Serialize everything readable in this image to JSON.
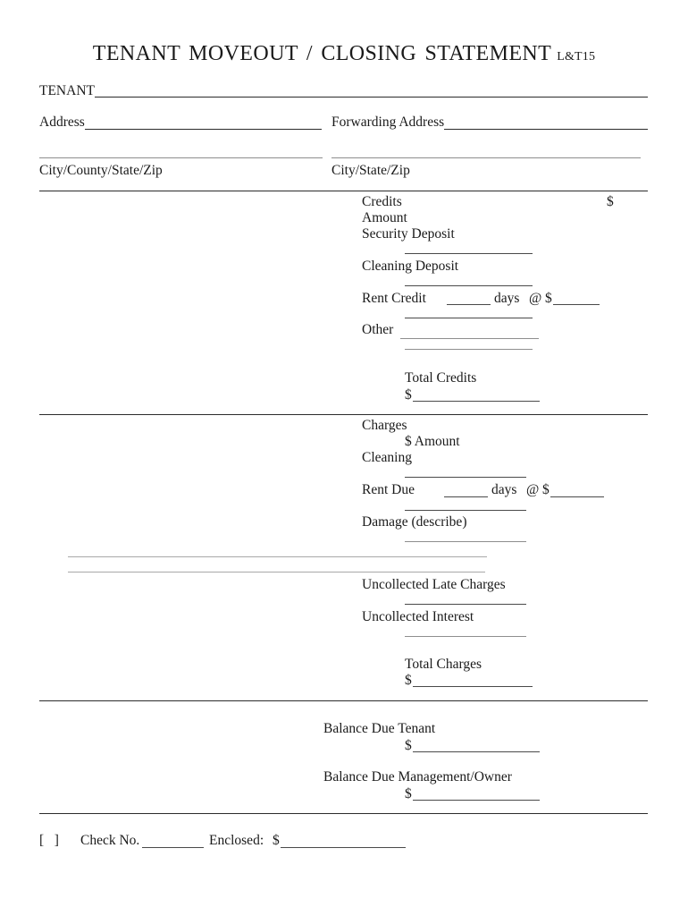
{
  "document": {
    "title": "TENANT  MOVEOUT / CLOSING  STATEMENT",
    "form_code": "L&T15"
  },
  "header_fields": {
    "tenant_label": "TENANT",
    "address_label": "Address",
    "forwarding_address_label": "Forwarding Address",
    "city_county_state_zip_label": "City/County/State/Zip",
    "city_state_zip_label": "City/State/Zip"
  },
  "credits_section": {
    "heading": "Credits",
    "currency_symbol": "$",
    "amount_label": "Amount",
    "rows": [
      {
        "label": "Security Deposit"
      },
      {
        "label": "Cleaning Deposit"
      },
      {
        "label": "Rent Credit",
        "days_word": "days",
        "at_symbol": "@",
        "currency_symbol": "$"
      },
      {
        "label": "Other"
      }
    ],
    "total_label": "Total Credits",
    "total_currency_symbol": "$"
  },
  "charges_section": {
    "heading": "Charges",
    "amount_label": "$ Amount",
    "rows": [
      {
        "label": "Cleaning"
      },
      {
        "label": "Rent Due",
        "days_word": "days",
        "at_symbol": "@",
        "currency_symbol": "$"
      },
      {
        "label": "Damage (describe)"
      },
      {
        "label": "Uncollected Late Charges"
      },
      {
        "label": "Uncollected Interest"
      }
    ],
    "total_label": "Total Charges",
    "total_currency_symbol": "$"
  },
  "balance_section": {
    "balance_due_tenant_label": "Balance Due Tenant",
    "balance_due_tenant_currency": "$",
    "balance_due_management_label": "Balance Due Management/Owner",
    "balance_due_management_currency": "$"
  },
  "footer": {
    "checkbox": "[   ]",
    "check_no_label": "Check No.",
    "enclosed_label": "Enclosed:",
    "enclosed_currency": "$"
  }
}
